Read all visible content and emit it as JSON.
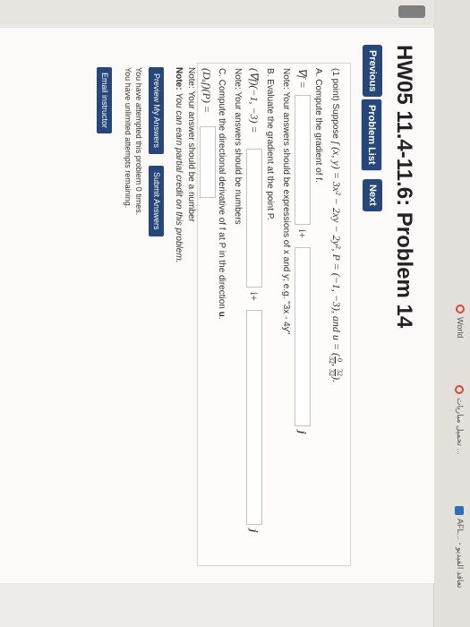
{
  "bookmarks": {
    "item1": "AFL... - تعاقد الفيديو",
    "item2": "تحميل مباريات ...",
    "item3": "World"
  },
  "colors": {
    "accent": "#27477a",
    "bookmark_icon": "#2f6db5"
  },
  "header": {
    "title": "HW05 11.4-11.6: Problem 14"
  },
  "nav": {
    "previous": "Previous",
    "problem_list": "Problem List",
    "next": "Next"
  },
  "problem": {
    "intro": "(1 point) Suppose",
    "func": "f (x, y) = 3x² − 2xy − 2y²,  P = (−1, −3), and u = (",
    "u_frac1_num": "0",
    "u_frac1_den": "32",
    "u_frac2_num": "32",
    "u_frac2_den": "32",
    "func_end": ").",
    "partA": "A. Compute the gradient of f.",
    "grad_label": "∇f =",
    "unit_i": "i+",
    "unit_j": "j",
    "noteA": "Note: Your answers should be expressions of x and y; e.g. \"3x - 4y\"",
    "partB": "B. Evaluate the gradient at the point P.",
    "grad_at_label": "(∇f)(−1, −3) =",
    "noteB": "Note: Your answers should be numbers",
    "partC_prefix": "C. Compute the directional derivative of f at P in the direction ",
    "partC_u": "u",
    "partC_end": ".",
    "dir_label": "(Dᵤf)(P) =",
    "noteC": "Note: Your answer should be a number"
  },
  "footer": {
    "note_label": "Note:",
    "note_text": "You can earn partial credit on this problem.",
    "preview": "Preview My Answers",
    "submit": "Submit Answers",
    "attempts1": "You have attempted this problem 0 times.",
    "attempts2": "You have unlimited attempts remaining.",
    "email": "Email instructor"
  }
}
